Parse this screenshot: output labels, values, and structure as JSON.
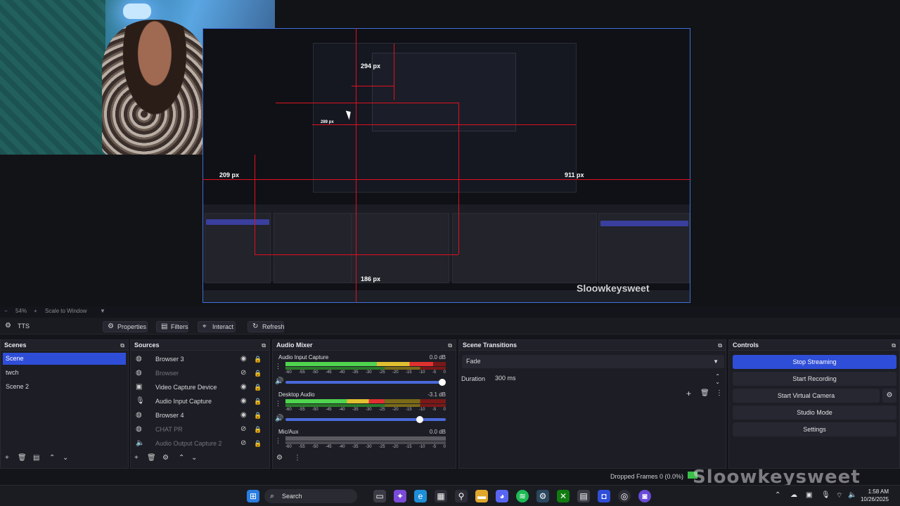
{
  "window": {
    "minimize": "—",
    "restore": "❐",
    "close": "✕"
  },
  "preview": {
    "labels": [
      "294 px",
      "289 px",
      "209 px",
      "911 px",
      "186 px"
    ],
    "watermark_nested": "Sloowkeysweet"
  },
  "zoom": {
    "minus": "−",
    "value": "54%",
    "plus": "+",
    "mode": "Scale to Window"
  },
  "source_toolbar": {
    "current_source": "TTS",
    "properties": "Properties",
    "filters": "Filters",
    "interact": "Interact",
    "refresh": "Refresh"
  },
  "scenes": {
    "title": "Scenes",
    "items": [
      "Scene",
      "twch",
      "Scene 2"
    ],
    "selected": 0
  },
  "sources": {
    "title": "Sources",
    "items": [
      {
        "label": "Browser 3",
        "visible": true
      },
      {
        "label": "Browser",
        "visible": false
      },
      {
        "label": "Video Capture Device",
        "visible": true
      },
      {
        "label": "Audio Input Capture",
        "visible": true
      },
      {
        "label": "Browser 4",
        "visible": true
      },
      {
        "label": "CHAT PR",
        "visible": false
      },
      {
        "label": "Audio Output Capture 2",
        "visible": false
      }
    ]
  },
  "audio_mixer": {
    "title": "Audio Mixer",
    "ticks": [
      "-60",
      "-55",
      "-50",
      "-45",
      "-40",
      "-35",
      "-30",
      "-25",
      "-20",
      "-15",
      "-10",
      "-5",
      "0"
    ],
    "channels": [
      {
        "name": "Audio Input Capture",
        "db": "0.0 dB",
        "level": 0.92,
        "volume": 1.0
      },
      {
        "name": "Desktop Audio",
        "db": "-3.1 dB",
        "level": 0.62,
        "volume": 0.86
      },
      {
        "name": "Mic/Aux",
        "db": "0.0 dB",
        "level": 0.0,
        "volume": 1.0
      }
    ]
  },
  "scene_transitions": {
    "title": "Scene Transitions",
    "transition": "Fade",
    "duration_label": "Duration",
    "duration_value": "300 ms"
  },
  "controls": {
    "title": "Controls",
    "stop_streaming": "Stop Streaming",
    "start_recording": "Start Recording",
    "start_virtual_camera": "Start Virtual Camera",
    "studio_mode": "Studio Mode",
    "settings": "Settings"
  },
  "status": {
    "dropped_frames": "Dropped Frames 0 (0.0%)",
    "watermark": "Sloowkeysweet"
  },
  "taskbar": {
    "search": "Search",
    "time": "1:58 AM",
    "date": "10/26/2025"
  },
  "colors": {
    "accent": "#2f4ed8",
    "guide_red": "#e01020",
    "meter_green": "#4fd44f"
  }
}
